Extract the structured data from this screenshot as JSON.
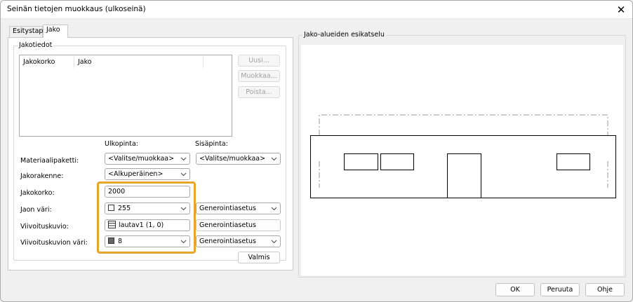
{
  "window": {
    "title": "Seinän tietojen muokkaus (ulkoseinä)"
  },
  "tabs": [
    {
      "label": "Esitystapa",
      "active": false
    },
    {
      "label": "Jako",
      "active": true
    }
  ],
  "jakotiedot": {
    "legend": "Jakotiedot",
    "columns": [
      "Jakokorko",
      "Jako"
    ],
    "buttons": {
      "new": "Uusi...",
      "edit": "Muokkaa...",
      "delete": "Poista..."
    }
  },
  "form": {
    "col_outer": "Ulkopinta:",
    "col_inner": "Sisäpinta:",
    "rows": {
      "material": {
        "label": "Materiaalipaketti:",
        "outer": "<Valitse/muokkaa>",
        "inner": "<Valitse/muokkaa>"
      },
      "structure": {
        "label": "Jakorakenne:",
        "outer": "<Alkuperäinen>"
      },
      "height": {
        "label": "Jakokorko:",
        "value": "2000"
      },
      "color": {
        "label": "Jaon väri:",
        "value": "255",
        "inner": "Generointiasetus"
      },
      "hatch": {
        "label": "Viivoituskuvio:",
        "value": "lautav1 (1, 0)",
        "inner": "Generointiasetus"
      },
      "hatch_color": {
        "label": "Viivoituskuvion väri:",
        "value": "8",
        "inner": "Generointiasetus"
      }
    },
    "done_button": "Valmis"
  },
  "preview": {
    "legend": "Jako-alueiden esikatselu"
  },
  "footer": {
    "ok": "OK",
    "cancel": "Peruuta",
    "help": "Ohje"
  },
  "colors": {
    "highlight": "#e8a52a",
    "swatch_color": "#ffffff",
    "swatch_hatch": "#666666"
  },
  "icons": {
    "close": "close-icon",
    "dropdown": "chevron-down-icon",
    "hatch": "hatch-pattern-icon"
  }
}
